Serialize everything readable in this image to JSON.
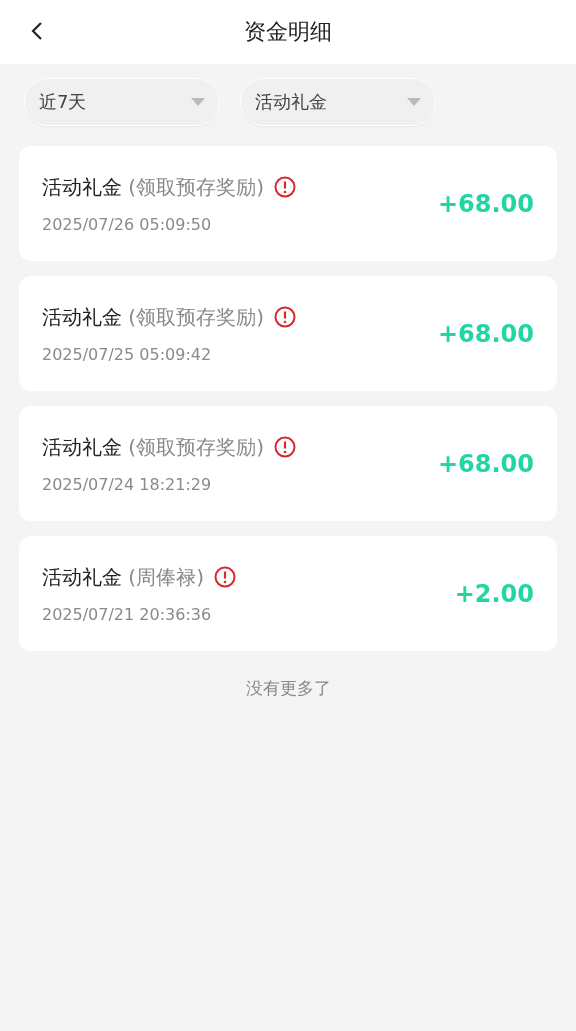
{
  "header": {
    "title": "资金明细"
  },
  "filters": [
    {
      "label": "近7天"
    },
    {
      "label": "活动礼金"
    }
  ],
  "records": [
    {
      "title": "活动礼金",
      "note": "(领取预存奖励)",
      "time": "2025/07/26 05:09:50",
      "amount": "+68.00"
    },
    {
      "title": "活动礼金",
      "note": "(领取预存奖励)",
      "time": "2025/07/25 05:09:42",
      "amount": "+68.00"
    },
    {
      "title": "活动礼金",
      "note": "(领取预存奖励)",
      "time": "2025/07/24 18:21:29",
      "amount": "+68.00"
    },
    {
      "title": "活动礼金",
      "note": "(周俸禄)",
      "time": "2025/07/21 20:36:36",
      "amount": "+2.00"
    }
  ],
  "footer_text": "没有更多了"
}
